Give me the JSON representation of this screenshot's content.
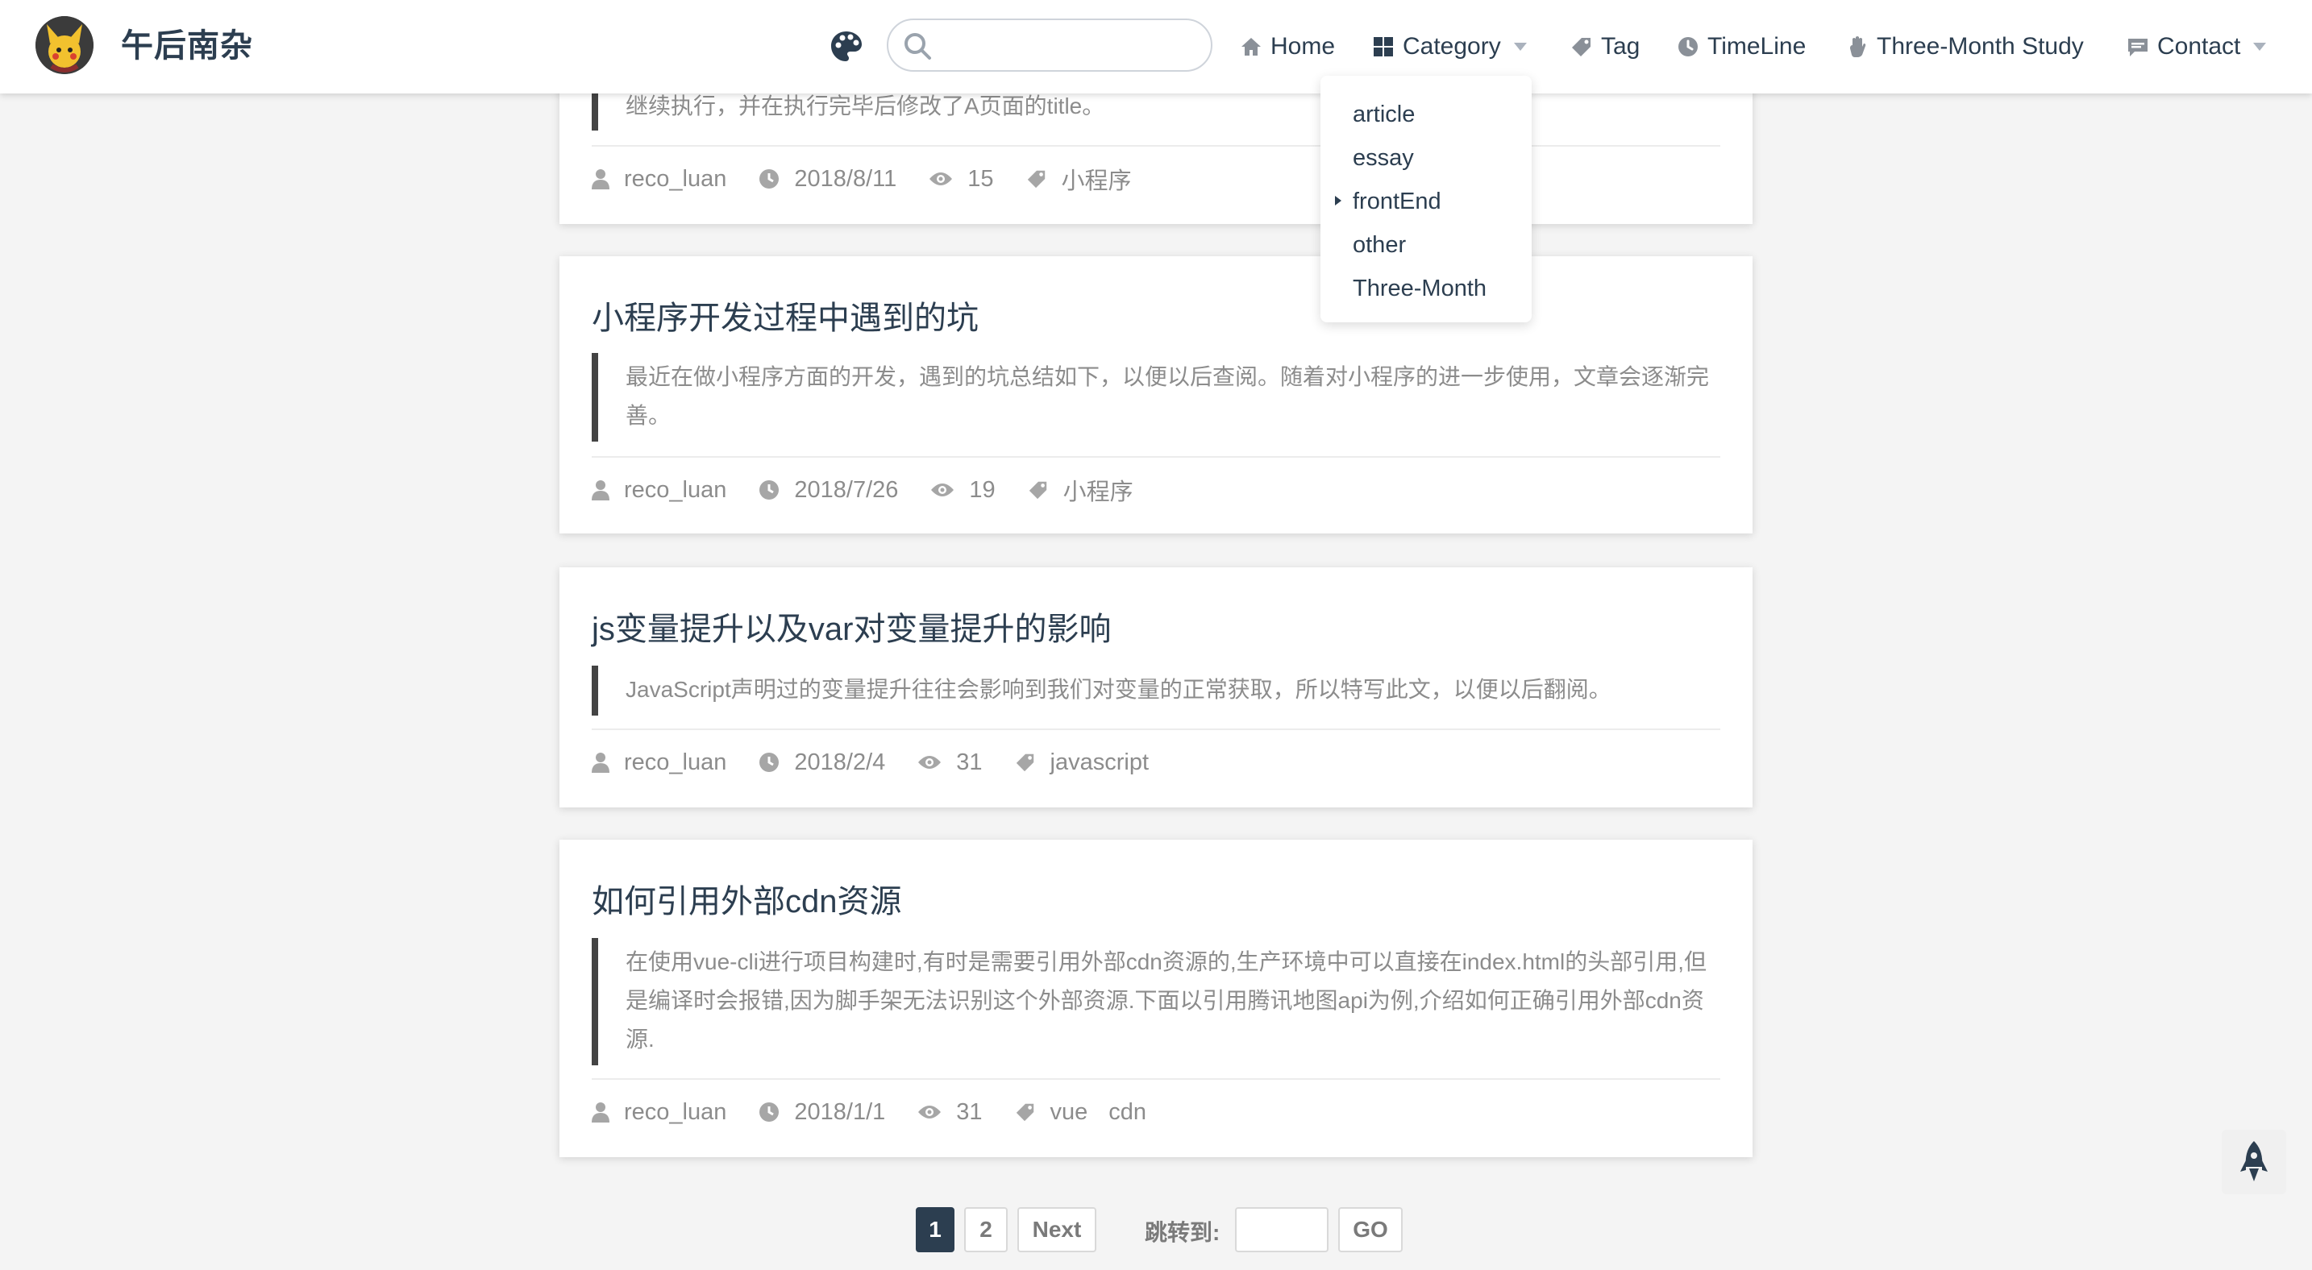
{
  "site": {
    "title": "午后南杂"
  },
  "search": {
    "placeholder": ""
  },
  "nav": {
    "items": [
      {
        "label": "Home",
        "icon": "home-icon"
      },
      {
        "label": "Category",
        "icon": "category-icon",
        "dropdown": true
      },
      {
        "label": "Tag",
        "icon": "tag-icon"
      },
      {
        "label": "TimeLine",
        "icon": "clock-icon"
      },
      {
        "label": "Three-Month Study",
        "icon": "hand-icon"
      },
      {
        "label": "Contact",
        "icon": "message-icon",
        "dropdown": true
      }
    ]
  },
  "category_dropdown": {
    "items": [
      "article",
      "essay",
      "frontEnd",
      "other",
      "Three-Month"
    ],
    "active": "frontEnd"
  },
  "posts": [
    {
      "title": "",
      "excerpt": "继续执行，并在执行完毕后修改了A页面的title。",
      "author": "reco_luan",
      "date": "2018/8/11",
      "views": "15",
      "tags": [
        "小程序"
      ]
    },
    {
      "title": "小程序开发过程中遇到的坑",
      "excerpt": "最近在做小程序方面的开发，遇到的坑总结如下，以便以后查阅。随着对小程序的进一步使用，文章会逐渐完善。",
      "author": "reco_luan",
      "date": "2018/7/26",
      "views": "19",
      "tags": [
        "小程序"
      ]
    },
    {
      "title": "js变量提升以及var对变量提升的影响",
      "excerpt": "JavaScript声明过的变量提升往往会影响到我们对变量的正常获取，所以特写此文，以便以后翻阅。",
      "author": "reco_luan",
      "date": "2018/2/4",
      "views": "31",
      "tags": [
        "javascript"
      ]
    },
    {
      "title": "如何引用外部cdn资源",
      "excerpt": "在使用vue-cli进行项目构建时,有时是需要引用外部cdn资源的,生产环境中可以直接在index.html的头部引用,但是编译时会报错,因为脚手架无法识别这个外部资源.下面以引用腾讯地图api为例,介绍如何正确引用外部cdn资源.",
      "author": "reco_luan",
      "date": "2018/1/1",
      "views": "31",
      "tags": [
        "vue",
        "cdn"
      ]
    }
  ],
  "pagination": {
    "pages": [
      "1",
      "2"
    ],
    "current": "1",
    "next_label": "Next",
    "jump_label": "跳转到:",
    "jump_value": "",
    "go_label": "GO"
  },
  "colors": {
    "accent": "#2c3e50",
    "muted": "#8c8c8c",
    "background": "#f4f4f4"
  }
}
